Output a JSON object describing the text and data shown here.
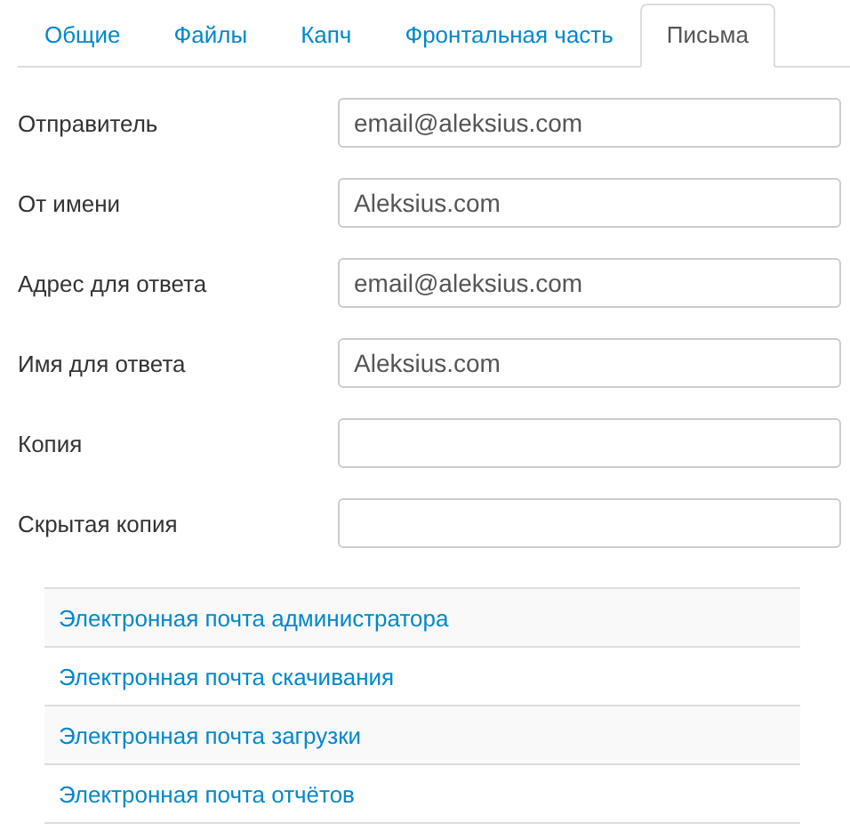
{
  "tabs": [
    {
      "label": "Общие",
      "selected": false
    },
    {
      "label": "Файлы",
      "selected": false
    },
    {
      "label": "Капч",
      "selected": false
    },
    {
      "label": "Фронтальная часть",
      "selected": false
    },
    {
      "label": "Письма",
      "selected": true
    }
  ],
  "fields": [
    {
      "label": "Отправитель",
      "value": "email@aleksius.com"
    },
    {
      "label": "От имени",
      "value": "Aleksius.com"
    },
    {
      "label": "Адрес для ответа",
      "value": "email@aleksius.com"
    },
    {
      "label": "Имя для ответа",
      "value": "Aleksius.com"
    },
    {
      "label": "Копия"
    },
    {
      "label": "Скрытая копия"
    }
  ],
  "sections": [
    {
      "title": "Электронная почта администратора"
    },
    {
      "title": "Электронная почта скачивания"
    },
    {
      "title": "Электронная почта загрузки"
    },
    {
      "title": "Электронная почта отчётов"
    }
  ]
}
